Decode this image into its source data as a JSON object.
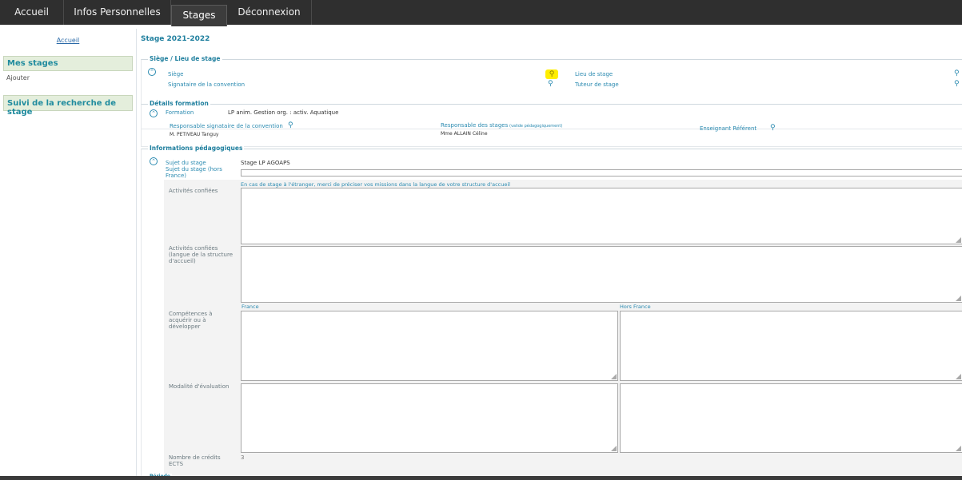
{
  "nav": {
    "tabs": [
      {
        "label": "Accueil"
      },
      {
        "label": "Infos Personnelles"
      },
      {
        "label": "Stages"
      },
      {
        "label": "Déconnexion"
      }
    ]
  },
  "sidebar": {
    "home_link": "Accueil",
    "section1": "Mes stages",
    "add_label": "Ajouter",
    "section2": "Suivi de la recherche de stage"
  },
  "page_title": "Stage 2021-2022",
  "siege": {
    "legend": "Siège / Lieu de stage",
    "siege_label": "Siège",
    "signataire_label": "Signataire de la convention",
    "lieu_label": "Lieu de stage",
    "tuteur_label": "Tuteur de stage"
  },
  "formation": {
    "legend": "Détails formation",
    "formation_label": "Formation",
    "formation_value": "LP anim. Gestion org. : activ. Aquatique",
    "resp_sign_label": "Responsable signataire de la convention",
    "resp_sign_value": "M. PETIVEAU Tanguy",
    "resp_stages_label": "Responsable des stages",
    "resp_stages_note": "(valide pédagogiquement)",
    "resp_stages_value": "Mme ALLAIN Céline",
    "enseignant_label": "Enseignant Référent"
  },
  "pedago": {
    "legend": "Informations pédagogiques",
    "sujet_label": "Sujet du stage",
    "sujet_value": "Stage LP AGOAPS",
    "sujet_hf_label": "Sujet du stage (hors France)",
    "hint": "En cas de stage à l'étranger, merci de préciser vos missions dans la langue de votre structure d'accueil",
    "activites_label": "Activités confiées",
    "activites_langue_label": "Activités confiées (langue de la structure d'accueil)",
    "col_france": "France",
    "col_hors_france": "Hors France",
    "competences_label": "Compétences à acquérir ou à développer",
    "modalite_label": "Modalité d'évaluation",
    "ects_label": "Nombre de crédits ECTS",
    "ects_value": "3"
  },
  "next_legend": "Période"
}
